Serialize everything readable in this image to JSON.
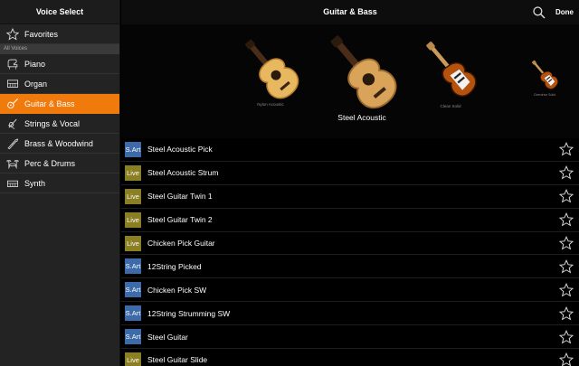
{
  "sidebar": {
    "title": "Voice Select",
    "favorites_label": "Favorites",
    "section_label": "All Voices",
    "items": [
      {
        "label": "Piano",
        "icon": "piano-icon"
      },
      {
        "label": "Organ",
        "icon": "organ-icon"
      },
      {
        "label": "Guitar & Bass",
        "icon": "guitar-icon",
        "active": true
      },
      {
        "label": "Strings & Vocal",
        "icon": "strings-icon"
      },
      {
        "label": "Brass & Woodwind",
        "icon": "brass-icon"
      },
      {
        "label": "Perc & Drums",
        "icon": "drums-icon"
      },
      {
        "label": "Synth",
        "icon": "synth-icon"
      }
    ]
  },
  "header": {
    "title": "Guitar & Bass",
    "done_label": "Done"
  },
  "carousel": {
    "items": [
      {
        "label": "Nylon Acoustic",
        "kind": "nylon"
      },
      {
        "label": "Steel Acoustic",
        "kind": "steel",
        "selected": true
      },
      {
        "label": "Clean Solid",
        "kind": "electric"
      },
      {
        "label": "Overdrive Solid",
        "kind": "electric-small"
      }
    ]
  },
  "voices": [
    {
      "badge": "S.Art",
      "name": "Steel Acoustic Pick"
    },
    {
      "badge": "Live",
      "name": "Steel Acoustic Strum"
    },
    {
      "badge": "Live",
      "name": "Steel Guitar Twin 1"
    },
    {
      "badge": "Live",
      "name": "Steel Guitar Twin 2"
    },
    {
      "badge": "Live",
      "name": "Chicken Pick Guitar"
    },
    {
      "badge": "S.Art",
      "name": "12String Picked"
    },
    {
      "badge": "S.Art",
      "name": "Chicken Pick SW"
    },
    {
      "badge": "S.Art",
      "name": "12String Strumming SW"
    },
    {
      "badge": "S.Art",
      "name": "Steel Guitar"
    },
    {
      "badge": "Live",
      "name": "Steel Guitar Slide"
    }
  ],
  "colors": {
    "accent": "#f07a0c",
    "sart_badge": "#3d6aa8",
    "live_badge": "#8a7f22"
  }
}
